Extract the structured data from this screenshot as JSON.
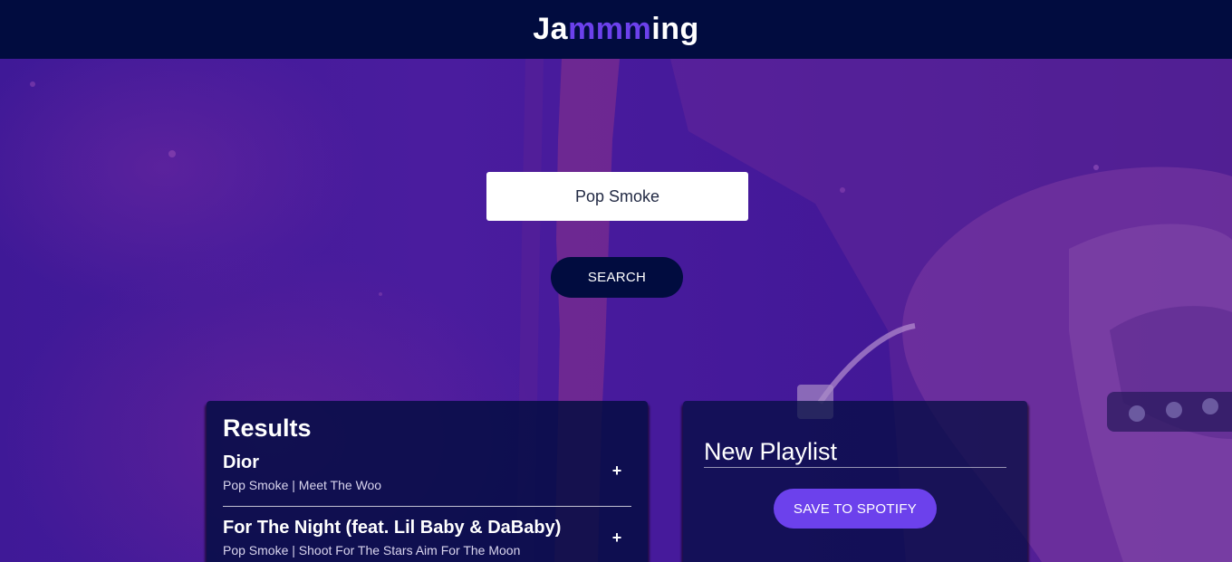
{
  "header": {
    "logo_prefix": "Ja",
    "logo_accent": "mmm",
    "logo_suffix": "ing"
  },
  "search": {
    "value": "Pop Smoke",
    "button_label": "SEARCH"
  },
  "results": {
    "title": "Results",
    "tracks": [
      {
        "name": "Dior",
        "info": "Pop Smoke | Meet The Woo",
        "action": "+"
      },
      {
        "name": "For The Night (feat. Lil Baby & DaBaby)",
        "info": "Pop Smoke | Shoot For The Stars Aim For The Moon",
        "action": "+"
      }
    ]
  },
  "playlist": {
    "name_value": "New Playlist",
    "save_label": "SAVE TO SPOTIFY"
  },
  "colors": {
    "header_bg": "#010c3f",
    "accent": "#6c41ec",
    "background": "#3b1694"
  }
}
